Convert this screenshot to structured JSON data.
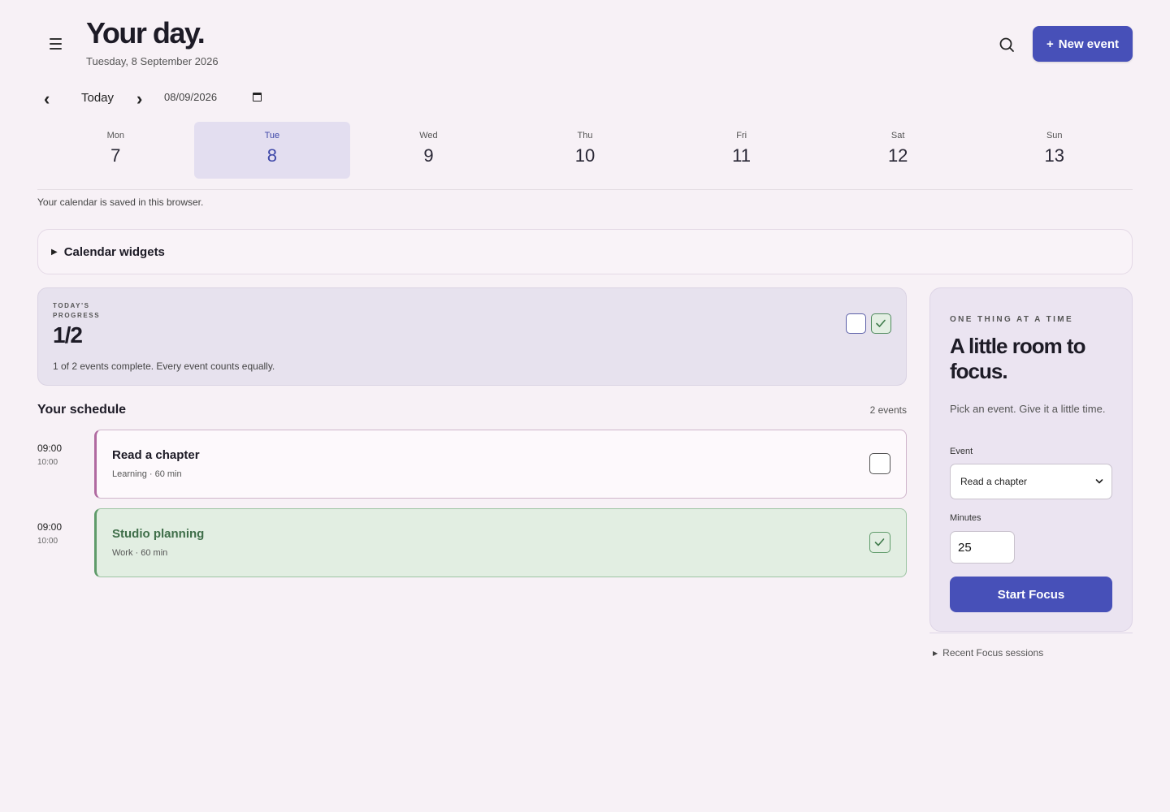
{
  "header": {
    "title": "Your day.",
    "date_subtitle": "Tuesday, 8 September 2026",
    "new_event_label": "New event",
    "new_event_icon": "+"
  },
  "date_nav": {
    "prev": "‹",
    "today_label": "Today",
    "next": "›",
    "date_value": "08/09/2026"
  },
  "week": [
    {
      "name": "Mon",
      "num": "7"
    },
    {
      "name": "Tue",
      "num": "8"
    },
    {
      "name": "Wed",
      "num": "9"
    },
    {
      "name": "Thu",
      "num": "10"
    },
    {
      "name": "Fri",
      "num": "11"
    },
    {
      "name": "Sat",
      "num": "12"
    },
    {
      "name": "Sun",
      "num": "13"
    }
  ],
  "saved_note": "Your calendar is saved in this browser.",
  "widgets": {
    "label": "Calendar widgets",
    "toggle": "▶"
  },
  "progress": {
    "label": "TODAY'S PROGRESS",
    "value": "1/2",
    "description": "1 of 2 events complete. Every event counts equally."
  },
  "schedule": {
    "title": "Your schedule",
    "count": "2 events",
    "events": [
      {
        "start": "09:00",
        "end": "10:00",
        "title": "Read a chapter",
        "meta": "Learning · 60 min",
        "done": false
      },
      {
        "start": "09:00",
        "end": "10:00",
        "title": "Studio planning",
        "meta": "Work · 60 min",
        "done": true
      }
    ]
  },
  "focus": {
    "label": "ONE THING AT A TIME",
    "headline": "A little room to focus.",
    "description": "Pick an event. Give it a little time.",
    "event_label": "Event",
    "event_value": "Read a chapter",
    "minutes_label": "Minutes",
    "minutes_value": "25",
    "start_label": "Start Focus"
  },
  "recent_sessions": {
    "label": "Recent Focus sessions",
    "toggle": "▶"
  },
  "colors": {
    "accent": "#4750b8",
    "background": "#f7f1f6",
    "done_green": "#5f9b6a",
    "learning_pink": "#b06aa0"
  }
}
